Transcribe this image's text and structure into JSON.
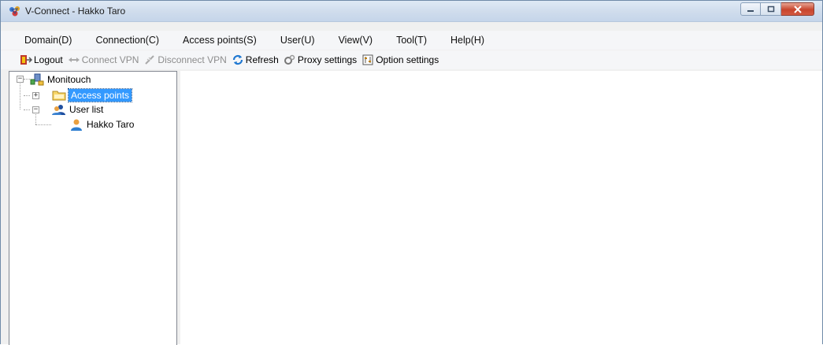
{
  "window": {
    "title": "V-Connect - Hakko Taro"
  },
  "menu": {
    "items": [
      "Domain(D)",
      "Connection(C)",
      "Access points(S)",
      "User(U)",
      "View(V)",
      "Tool(T)",
      "Help(H)"
    ]
  },
  "toolbar": {
    "logout": "Logout",
    "connect_vpn": "Connect VPN",
    "disconnect_vpn": "Disconnect VPN",
    "refresh": "Refresh",
    "proxy_settings": "Proxy settings",
    "option_settings": "Option settings"
  },
  "tree": {
    "root": "Monitouch",
    "access_points": "Access points",
    "user_list": "User list",
    "user": "Hakko Taro"
  },
  "colors": {
    "selection": "#3399ff",
    "titlebar": "#cfdcec"
  }
}
